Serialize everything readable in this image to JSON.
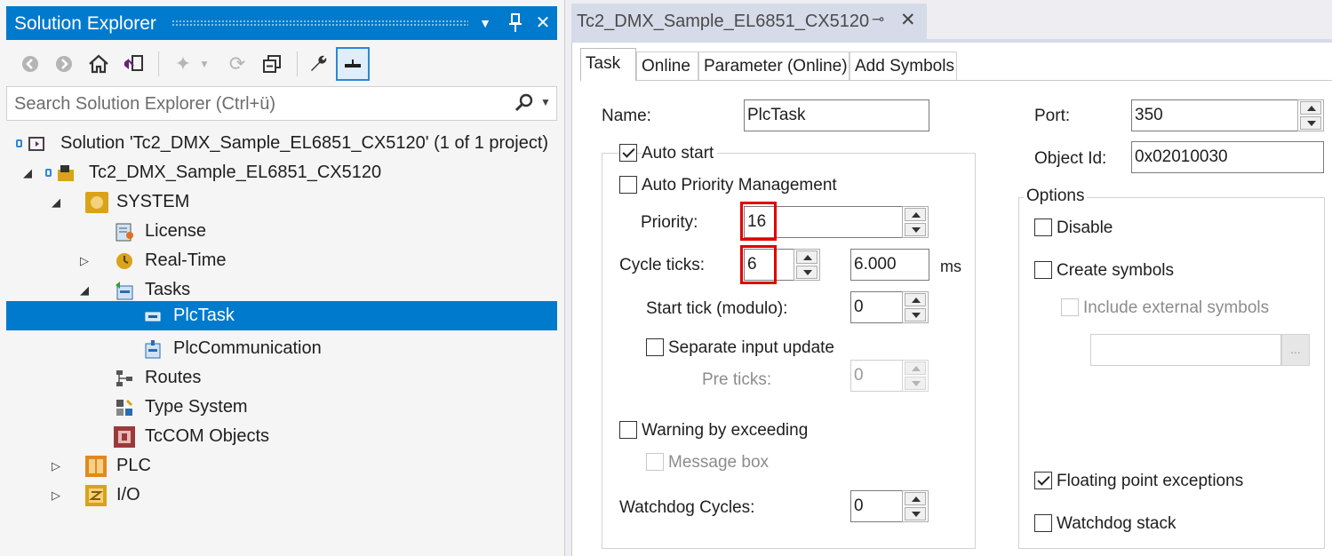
{
  "solution_explorer": {
    "title": "Solution Explorer",
    "search_placeholder": "Search Solution Explorer (Ctrl+ü)",
    "tree": [
      {
        "label": "Solution 'Tc2_DMX_Sample_EL6851_CX5120' (1 of 1 project)",
        "icon": "solution-icon"
      },
      {
        "label": "Tc2_DMX_Sample_EL6851_CX5120",
        "icon": "twincat-project-icon"
      },
      {
        "label": "SYSTEM",
        "icon": "system-icon"
      },
      {
        "label": "License",
        "icon": "license-icon"
      },
      {
        "label": "Real-Time",
        "icon": "realtime-icon"
      },
      {
        "label": "Tasks",
        "icon": "tasks-icon"
      },
      {
        "label": "PlcTask",
        "icon": "task-icon",
        "selected": true
      },
      {
        "label": "PlcCommunication",
        "icon": "task-icon"
      },
      {
        "label": "Routes",
        "icon": "routes-icon"
      },
      {
        "label": "Type System",
        "icon": "type-system-icon"
      },
      {
        "label": "TcCOM Objects",
        "icon": "tccom-icon"
      },
      {
        "label": "PLC",
        "icon": "plc-icon"
      },
      {
        "label": "I/O",
        "icon": "io-icon"
      }
    ]
  },
  "document": {
    "tab_title": "Tc2_DMX_Sample_EL6851_CX5120",
    "inner_tabs": [
      "Task",
      "Online",
      "Parameter (Online)",
      "Add Symbols"
    ],
    "form": {
      "name_label": "Name:",
      "name_value": "PlcTask",
      "port_label": "Port:",
      "port_value": "350",
      "object_id_label": "Object Id:",
      "object_id_value": "0x02010030",
      "auto_start": "Auto start",
      "auto_priority": "Auto Priority Management",
      "priority_label": "Priority:",
      "priority_value": "16",
      "cycle_ticks_label": "Cycle ticks:",
      "cycle_ticks_value": "6",
      "cycle_time_value": "6.000",
      "cycle_time_unit": "ms",
      "start_tick_label": "Start tick (modulo):",
      "start_tick_value": "0",
      "separate_input": "Separate input update",
      "pre_ticks_label": "Pre ticks:",
      "pre_ticks_value": "0",
      "warning_exceeding": "Warning by exceeding",
      "message_box": "Message box",
      "watchdog_cycles_label": "Watchdog Cycles:",
      "watchdog_cycles_value": "0"
    },
    "options": {
      "title": "Options",
      "disable": "Disable",
      "create_symbols": "Create symbols",
      "include_external": "Include external symbols",
      "browse": "...",
      "floating_point": "Floating point exceptions",
      "watchdog_stack": "Watchdog stack"
    }
  },
  "colors": {
    "accent": "#007acc",
    "highlight": "#e00000"
  }
}
